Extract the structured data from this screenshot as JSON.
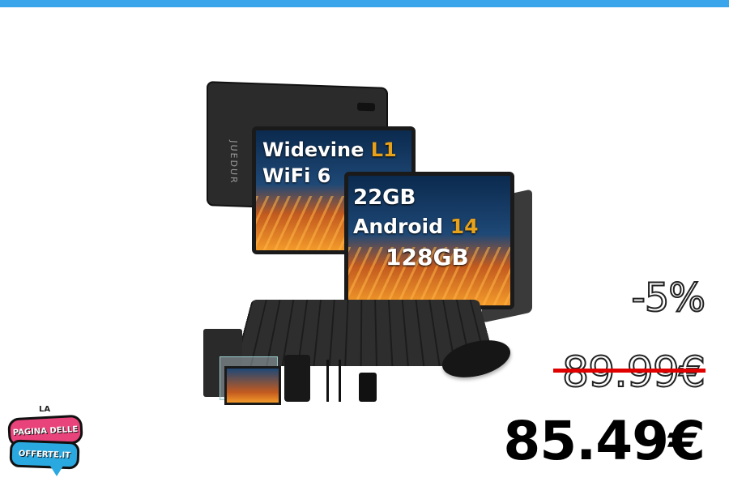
{
  "header": {
    "bar_color": "#3aa5ea"
  },
  "product": {
    "back_brand": "JUEDUR",
    "screen1": {
      "line1": "Widevine ",
      "line1_accent": "L1",
      "line2": "WiFi 6"
    },
    "screen2": {
      "line1": "22GB",
      "line2": "Android ",
      "line2_accent": "14",
      "line3": "128GB"
    },
    "accent_color": "#e8a21a"
  },
  "price": {
    "discount": "-5%",
    "old_price": "89.99€",
    "new_price": "85.49€",
    "strike_color": "#e00000"
  },
  "logo": {
    "top_word": "LA",
    "line1": "PAGINA DELLE",
    "line2": "OFFERTE.IT",
    "colors": {
      "pink": "#e8437a",
      "blue": "#2aa9e0"
    }
  }
}
